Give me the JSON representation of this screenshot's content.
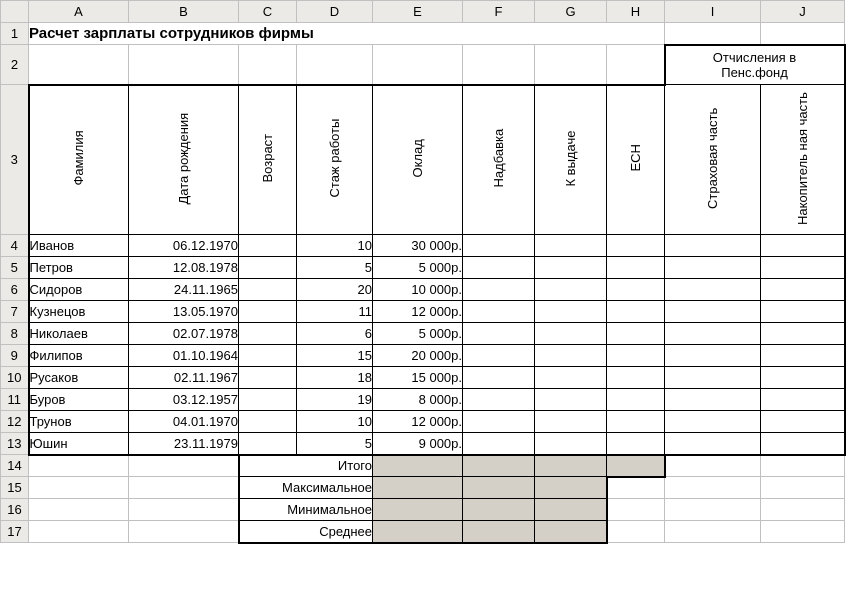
{
  "columns": [
    "A",
    "B",
    "C",
    "D",
    "E",
    "F",
    "G",
    "H",
    "I",
    "J"
  ],
  "rows": [
    "1",
    "2",
    "3",
    "4",
    "5",
    "6",
    "7",
    "8",
    "9",
    "10",
    "11",
    "12",
    "13",
    "14",
    "15",
    "16",
    "17"
  ],
  "title": "Расчет зарплаты сотрудников фирмы",
  "pension_group": {
    "line1": "Отчисления в",
    "line2": "Пенс.фонд"
  },
  "headers": {
    "A": "Фамилия",
    "B": "Дата рождения",
    "C": "Возраст",
    "D": "Стаж работы",
    "E": "Оклад",
    "F": "Надбавка",
    "G": "К выдаче",
    "H": "ЕСН",
    "I": "Страховая часть",
    "J": "Накопитель ная часть"
  },
  "data": [
    {
      "name": "Иванов",
      "dob": "06.12.1970",
      "stazh": "10",
      "oklad": "30 000р."
    },
    {
      "name": "Петров",
      "dob": "12.08.1978",
      "stazh": "5",
      "oklad": "5 000р."
    },
    {
      "name": "Сидоров",
      "dob": "24.11.1965",
      "stazh": "20",
      "oklad": "10 000р."
    },
    {
      "name": "Кузнецов",
      "dob": "13.05.1970",
      "stazh": "11",
      "oklad": "12 000р."
    },
    {
      "name": "Николаев",
      "dob": "02.07.1978",
      "stazh": "6",
      "oklad": "5 000р."
    },
    {
      "name": "Филипов",
      "dob": "01.10.1964",
      "stazh": "15",
      "oklad": "20 000р."
    },
    {
      "name": "Русаков",
      "dob": "02.11.1967",
      "stazh": "18",
      "oklad": "15 000р."
    },
    {
      "name": "Буров",
      "dob": "03.12.1957",
      "stazh": "19",
      "oklad": "8 000р."
    },
    {
      "name": "Трунов",
      "dob": "04.01.1970",
      "stazh": "10",
      "oklad": "12 000р."
    },
    {
      "name": "Юшин",
      "dob": "23.11.1979",
      "stazh": "5",
      "oklad": "9 000р."
    }
  ],
  "summary": {
    "itogo": "Итого",
    "max": "Максимальное",
    "min": "Минимальное",
    "avg": "Среднее"
  },
  "chart_data": {
    "type": "table",
    "title": "Расчет зарплаты сотрудников фирмы",
    "columns": [
      "Фамилия",
      "Дата рождения",
      "Возраст",
      "Стаж работы",
      "Оклад",
      "Надбавка",
      "К выдаче",
      "ЕСН",
      "Страховая часть",
      "Накопительная часть"
    ],
    "rows": [
      [
        "Иванов",
        "06.12.1970",
        null,
        10,
        30000,
        null,
        null,
        null,
        null,
        null
      ],
      [
        "Петров",
        "12.08.1978",
        null,
        5,
        5000,
        null,
        null,
        null,
        null,
        null
      ],
      [
        "Сидоров",
        "24.11.1965",
        null,
        20,
        10000,
        null,
        null,
        null,
        null,
        null
      ],
      [
        "Кузнецов",
        "13.05.1970",
        null,
        11,
        12000,
        null,
        null,
        null,
        null,
        null
      ],
      [
        "Николаев",
        "02.07.1978",
        null,
        6,
        5000,
        null,
        null,
        null,
        null,
        null
      ],
      [
        "Филипов",
        "01.10.1964",
        null,
        15,
        20000,
        null,
        null,
        null,
        null,
        null
      ],
      [
        "Русаков",
        "02.11.1967",
        null,
        18,
        15000,
        null,
        null,
        null,
        null,
        null
      ],
      [
        "Буров",
        "03.12.1957",
        null,
        19,
        8000,
        null,
        null,
        null,
        null,
        null
      ],
      [
        "Трунов",
        "04.01.1970",
        null,
        10,
        12000,
        null,
        null,
        null,
        null,
        null
      ],
      [
        "Юшин",
        "23.11.1979",
        null,
        5,
        9000,
        null,
        null,
        null,
        null,
        null
      ]
    ],
    "currency": "р."
  }
}
